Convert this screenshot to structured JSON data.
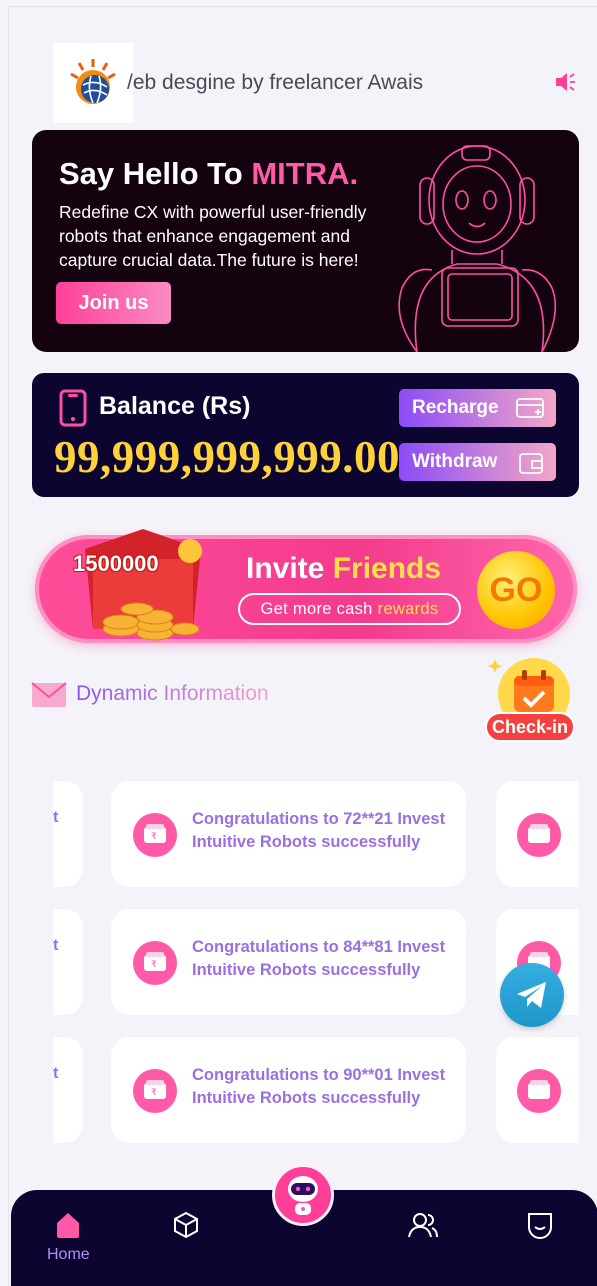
{
  "header": {
    "ticker_text": "/eb desgine by freelancer Awais",
    "logo_icon": "globe-sun-logo",
    "speaker_icon": "speaker-icon"
  },
  "hero": {
    "title_prefix": "Say Hello To ",
    "title_accent": "MITRA.",
    "description": "Redefine CX with powerful user-friendly robots that enhance engagement and capture crucial data.The future is here!",
    "join_label": "Join us",
    "accent_color": "#ff5aa8"
  },
  "balance": {
    "label": "Balance (Rs)",
    "value": "99,999,999,999.00",
    "recharge_label": "Recharge",
    "withdraw_label": "Withdraw"
  },
  "invite": {
    "amount": "1500000",
    "title_white": "Invite ",
    "title_yellow": "Friends",
    "sub_white": "Get more cash",
    "sub_yellow": "rewards",
    "go_label": "GO"
  },
  "dynamic": {
    "title": "Dynamic Information",
    "checkin_label": "Check-in"
  },
  "feed": [
    {
      "text": "Congratulations to 72**21 Invest Intuitive Robots successfully"
    },
    {
      "text": "Congratulations to 84**81 Invest Intuitive Robots successfully"
    },
    {
      "text": "Congratulations to 90**01 Invest Intuitive Robots successfully"
    }
  ],
  "feed_ghost_left": "t",
  "nav": {
    "home_label": "Home"
  }
}
